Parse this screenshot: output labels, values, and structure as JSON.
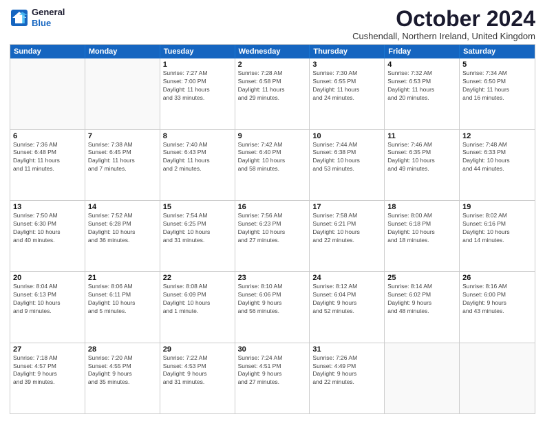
{
  "header": {
    "logo_line1": "General",
    "logo_line2": "Blue",
    "month_title": "October 2024",
    "location": "Cushendall, Northern Ireland, United Kingdom"
  },
  "days_of_week": [
    "Sunday",
    "Monday",
    "Tuesday",
    "Wednesday",
    "Thursday",
    "Friday",
    "Saturday"
  ],
  "weeks": [
    [
      {
        "day": "",
        "info": ""
      },
      {
        "day": "",
        "info": ""
      },
      {
        "day": "1",
        "info": "Sunrise: 7:27 AM\nSunset: 7:00 PM\nDaylight: 11 hours\nand 33 minutes."
      },
      {
        "day": "2",
        "info": "Sunrise: 7:28 AM\nSunset: 6:58 PM\nDaylight: 11 hours\nand 29 minutes."
      },
      {
        "day": "3",
        "info": "Sunrise: 7:30 AM\nSunset: 6:55 PM\nDaylight: 11 hours\nand 24 minutes."
      },
      {
        "day": "4",
        "info": "Sunrise: 7:32 AM\nSunset: 6:53 PM\nDaylight: 11 hours\nand 20 minutes."
      },
      {
        "day": "5",
        "info": "Sunrise: 7:34 AM\nSunset: 6:50 PM\nDaylight: 11 hours\nand 16 minutes."
      }
    ],
    [
      {
        "day": "6",
        "info": "Sunrise: 7:36 AM\nSunset: 6:48 PM\nDaylight: 11 hours\nand 11 minutes."
      },
      {
        "day": "7",
        "info": "Sunrise: 7:38 AM\nSunset: 6:45 PM\nDaylight: 11 hours\nand 7 minutes."
      },
      {
        "day": "8",
        "info": "Sunrise: 7:40 AM\nSunset: 6:43 PM\nDaylight: 11 hours\nand 2 minutes."
      },
      {
        "day": "9",
        "info": "Sunrise: 7:42 AM\nSunset: 6:40 PM\nDaylight: 10 hours\nand 58 minutes."
      },
      {
        "day": "10",
        "info": "Sunrise: 7:44 AM\nSunset: 6:38 PM\nDaylight: 10 hours\nand 53 minutes."
      },
      {
        "day": "11",
        "info": "Sunrise: 7:46 AM\nSunset: 6:35 PM\nDaylight: 10 hours\nand 49 minutes."
      },
      {
        "day": "12",
        "info": "Sunrise: 7:48 AM\nSunset: 6:33 PM\nDaylight: 10 hours\nand 44 minutes."
      }
    ],
    [
      {
        "day": "13",
        "info": "Sunrise: 7:50 AM\nSunset: 6:30 PM\nDaylight: 10 hours\nand 40 minutes."
      },
      {
        "day": "14",
        "info": "Sunrise: 7:52 AM\nSunset: 6:28 PM\nDaylight: 10 hours\nand 36 minutes."
      },
      {
        "day": "15",
        "info": "Sunrise: 7:54 AM\nSunset: 6:25 PM\nDaylight: 10 hours\nand 31 minutes."
      },
      {
        "day": "16",
        "info": "Sunrise: 7:56 AM\nSunset: 6:23 PM\nDaylight: 10 hours\nand 27 minutes."
      },
      {
        "day": "17",
        "info": "Sunrise: 7:58 AM\nSunset: 6:21 PM\nDaylight: 10 hours\nand 22 minutes."
      },
      {
        "day": "18",
        "info": "Sunrise: 8:00 AM\nSunset: 6:18 PM\nDaylight: 10 hours\nand 18 minutes."
      },
      {
        "day": "19",
        "info": "Sunrise: 8:02 AM\nSunset: 6:16 PM\nDaylight: 10 hours\nand 14 minutes."
      }
    ],
    [
      {
        "day": "20",
        "info": "Sunrise: 8:04 AM\nSunset: 6:13 PM\nDaylight: 10 hours\nand 9 minutes."
      },
      {
        "day": "21",
        "info": "Sunrise: 8:06 AM\nSunset: 6:11 PM\nDaylight: 10 hours\nand 5 minutes."
      },
      {
        "day": "22",
        "info": "Sunrise: 8:08 AM\nSunset: 6:09 PM\nDaylight: 10 hours\nand 1 minute."
      },
      {
        "day": "23",
        "info": "Sunrise: 8:10 AM\nSunset: 6:06 PM\nDaylight: 9 hours\nand 56 minutes."
      },
      {
        "day": "24",
        "info": "Sunrise: 8:12 AM\nSunset: 6:04 PM\nDaylight: 9 hours\nand 52 minutes."
      },
      {
        "day": "25",
        "info": "Sunrise: 8:14 AM\nSunset: 6:02 PM\nDaylight: 9 hours\nand 48 minutes."
      },
      {
        "day": "26",
        "info": "Sunrise: 8:16 AM\nSunset: 6:00 PM\nDaylight: 9 hours\nand 43 minutes."
      }
    ],
    [
      {
        "day": "27",
        "info": "Sunrise: 7:18 AM\nSunset: 4:57 PM\nDaylight: 9 hours\nand 39 minutes."
      },
      {
        "day": "28",
        "info": "Sunrise: 7:20 AM\nSunset: 4:55 PM\nDaylight: 9 hours\nand 35 minutes."
      },
      {
        "day": "29",
        "info": "Sunrise: 7:22 AM\nSunset: 4:53 PM\nDaylight: 9 hours\nand 31 minutes."
      },
      {
        "day": "30",
        "info": "Sunrise: 7:24 AM\nSunset: 4:51 PM\nDaylight: 9 hours\nand 27 minutes."
      },
      {
        "day": "31",
        "info": "Sunrise: 7:26 AM\nSunset: 4:49 PM\nDaylight: 9 hours\nand 22 minutes."
      },
      {
        "day": "",
        "info": ""
      },
      {
        "day": "",
        "info": ""
      }
    ]
  ]
}
